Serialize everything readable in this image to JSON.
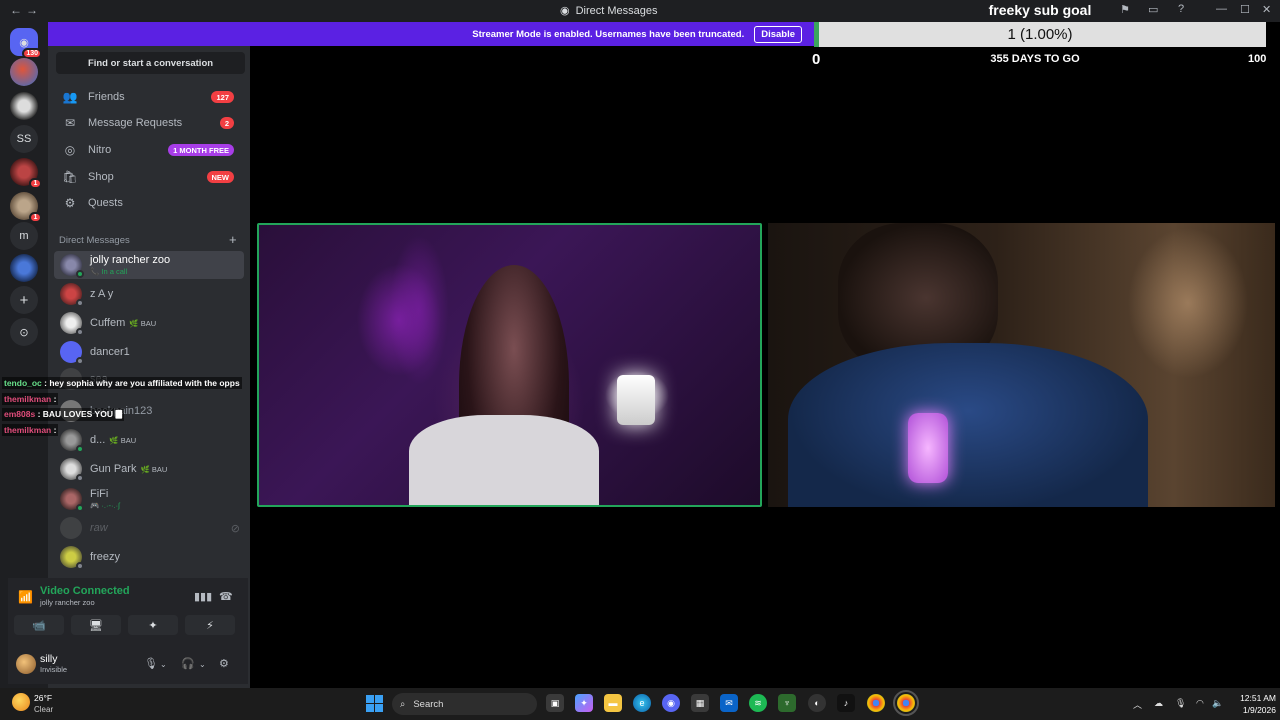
{
  "window": {
    "title": "Direct Messages",
    "back": "←",
    "forward": "→",
    "controls": [
      "⚑",
      "▭",
      "?",
      "—",
      "☐",
      "✕"
    ]
  },
  "banner": {
    "text": "Streamer Mode is enabled. Usernames have been truncated.",
    "button": "Disable"
  },
  "sub_goal": {
    "title": "freeky sub goal",
    "progress_text": "1 (1.00%)",
    "progress_fraction": 0.01,
    "min": "0",
    "days_left": "355 DAYS TO GO",
    "max": "100"
  },
  "servers": {
    "home_badge": "130",
    "ss_label": "SS",
    "m_label": "m",
    "badge_a": "1",
    "badge_b": "1"
  },
  "sidebar": {
    "search": "Find or start a conversation",
    "nav": [
      {
        "label": "Friends",
        "icon": "👥",
        "badge": "127"
      },
      {
        "label": "Message Requests",
        "icon": "✉",
        "badge": "2"
      },
      {
        "label": "Nitro",
        "icon": "◎",
        "badge": "1 MONTH FREE"
      },
      {
        "label": "Shop",
        "icon": "🛍",
        "badge": "NEW"
      },
      {
        "label": "Quests",
        "icon": "⚙",
        "badge": ""
      }
    ],
    "dm_header": "Direct Messages",
    "dm_plus": "+",
    "dms": [
      {
        "name": "jolly rancher zoo",
        "sub": "📞 In a call",
        "tag": ""
      },
      {
        "name": "z A y",
        "sub": "",
        "tag": ""
      },
      {
        "name": "Cuffem",
        "sub": "",
        "tag": "🌿 BAU"
      },
      {
        "name": "dancer1",
        "sub": "",
        "tag": ""
      },
      {
        "name": "sea",
        "sub": "",
        "tag": ""
      },
      {
        "name": "backpain123",
        "sub": "",
        "tag": ""
      },
      {
        "name": "d...",
        "sub": "",
        "tag": "🌿 BAU"
      },
      {
        "name": "Gun Park",
        "sub": "",
        "tag": "🌿 BAU"
      },
      {
        "name": "FiFi",
        "sub": "🎮 ·.·-·.·ʃ",
        "tag": ""
      },
      {
        "name": "raw",
        "sub": "",
        "tag": ""
      },
      {
        "name": "freezy",
        "sub": "",
        "tag": ""
      }
    ]
  },
  "chat_overlay": [
    {
      "user": "tendo_oc",
      "msg": " : hey sophia why are you affiliated with the opps"
    },
    {
      "user": "themilkman",
      "msg": " :"
    },
    {
      "user": "em808s",
      "msg": " : BAU LOVES YOU 🀫"
    },
    {
      "user": "themilkman",
      "msg": " :"
    }
  ],
  "voice": {
    "title": "Video Connected",
    "channel": "jolly rancher zoo",
    "buttons": [
      "📹",
      "🖥",
      "✦",
      "⚡"
    ]
  },
  "user": {
    "name": "silly",
    "status": "Invisible"
  },
  "taskbar": {
    "temp": "26°F",
    "condition": "Clear",
    "search": "Search",
    "time": "12:51 AM",
    "date": "1/9/2026"
  }
}
